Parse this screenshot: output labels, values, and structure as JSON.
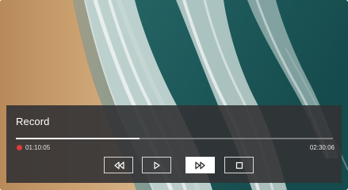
{
  "player": {
    "title": "Record",
    "current_time": "01:10:05",
    "total_time": "02:30:06",
    "progress_fraction": 0.39,
    "recording": true
  },
  "controls": [
    {
      "name": "rewind",
      "icon": "rewind-icon",
      "active": false
    },
    {
      "name": "play",
      "icon": "play-icon",
      "active": false
    },
    {
      "name": "fast-forward",
      "icon": "fast-forward-icon",
      "active": true
    },
    {
      "name": "stop",
      "icon": "stop-icon",
      "active": false
    }
  ],
  "colors": {
    "panel": "#323234",
    "recording_dot": "#e03b3b",
    "progress_fill": "#ffffff",
    "progress_track": "#7a7a7c"
  }
}
